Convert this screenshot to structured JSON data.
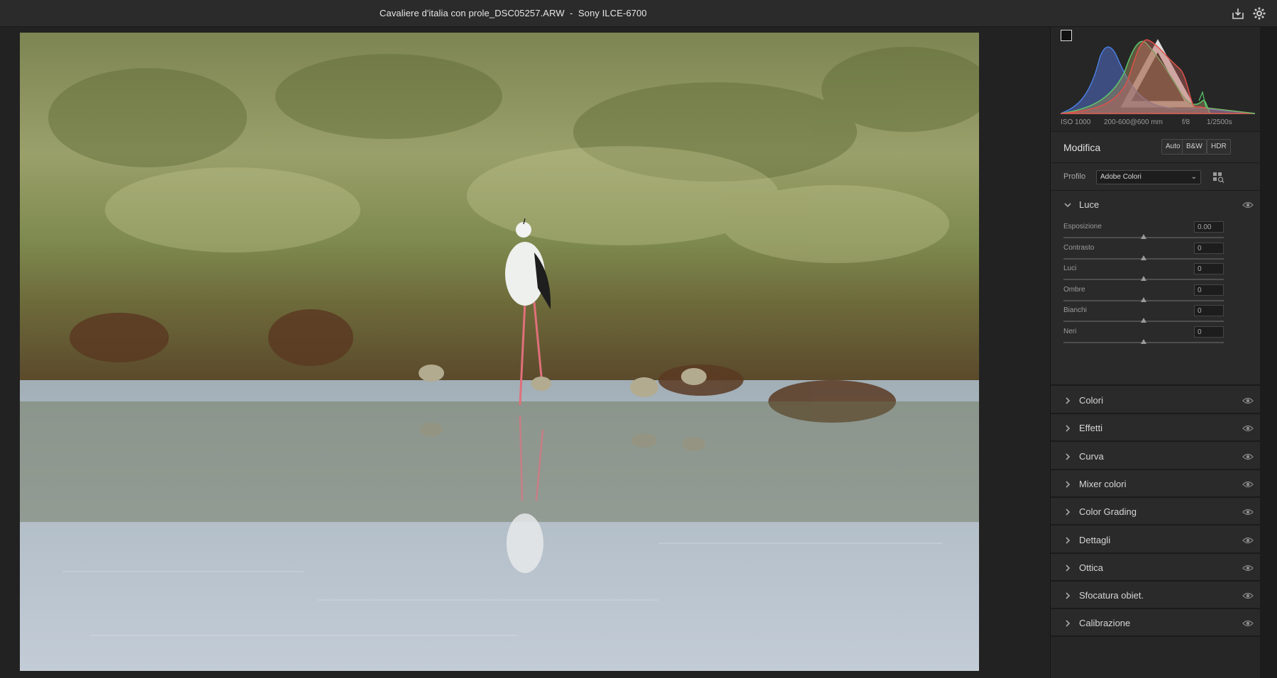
{
  "window": {
    "title": "Cavaliere d'italia con prole_DSC05257.ARW  -  Sony ILCE-6700"
  },
  "toolbar": {
    "export_icon": "save-download-icon",
    "settings_icon": "gear-icon"
  },
  "histogram": {
    "iso": "ISO 1000",
    "lens": "200-600@600 mm",
    "aperture": "f/8",
    "shutter": "1/2500s"
  },
  "edit": {
    "title": "Modifica",
    "buttons": [
      "Auto",
      "B&W",
      "HDR"
    ],
    "profile_label": "Profilo",
    "profile_value": "Adobe Colori"
  },
  "luce": {
    "label": "Luce",
    "sliders": [
      {
        "label": "Esposizione",
        "value": "0.00",
        "position": 0.5
      },
      {
        "label": "Contrasto",
        "value": "0",
        "position": 0.5
      },
      {
        "label": "Luci",
        "value": "0",
        "position": 0.5
      },
      {
        "label": "Ombre",
        "value": "0",
        "position": 0.5
      },
      {
        "label": "Bianchi",
        "value": "0",
        "position": 0.5
      },
      {
        "label": "Neri",
        "value": "0",
        "position": 0.5
      }
    ]
  },
  "sections": [
    {
      "label": "Colori"
    },
    {
      "label": "Effetti"
    },
    {
      "label": "Curva"
    },
    {
      "label": "Mixer colori"
    },
    {
      "label": "Color Grading"
    },
    {
      "label": "Dettagli"
    },
    {
      "label": "Ottica"
    },
    {
      "label": "Sfocatura obiet."
    },
    {
      "label": "Calibrazione"
    }
  ]
}
